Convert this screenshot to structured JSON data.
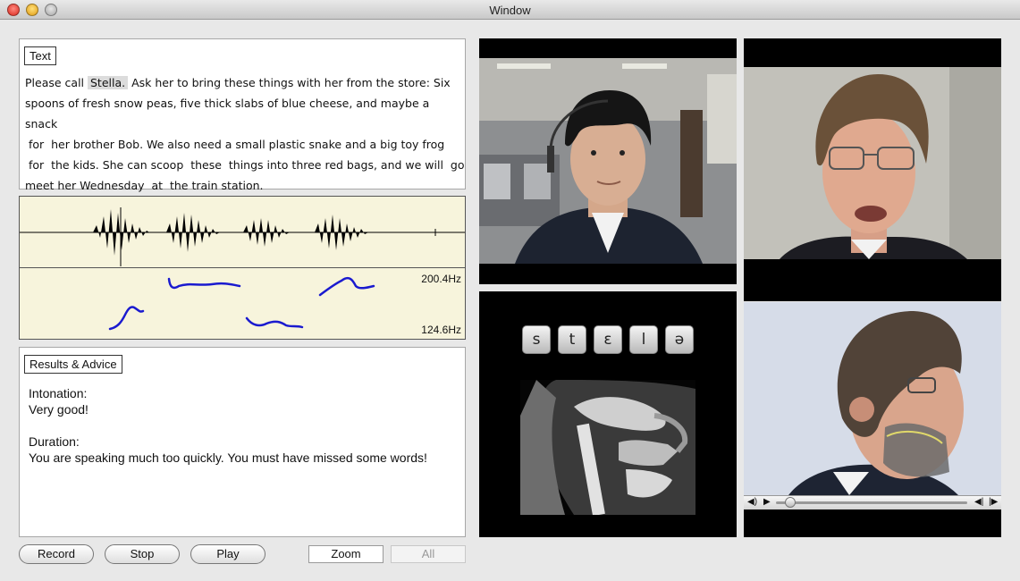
{
  "window": {
    "title": "Window"
  },
  "text_panel": {
    "legend": "Text",
    "lines": [
      [
        "Please call ",
        "Stella.",
        " Ask her to bring these things with her from the store: Six"
      ],
      "spoons of fresh snow peas, five thick slabs of blue cheese, and maybe a snack",
      " for  her brother Bob. We also need a small plastic snake and a big toy frog",
      " for  the kids. She can scoop  these  things into three red bags, and we will  go",
      "meet her Wednesday  at  the train station."
    ]
  },
  "pitch": {
    "max_label": "200.4Hz",
    "min_label": "124.6Hz"
  },
  "results": {
    "legend": "Results & Advice",
    "intonation_label": "Intonation:",
    "intonation_value": "Very good!",
    "duration_label": "Duration:",
    "duration_value": "You are speaking much too quickly. You must have missed some words!"
  },
  "buttons": {
    "record": "Record",
    "stop": "Stop",
    "play": "Play",
    "zoom": "Zoom",
    "all": "All"
  },
  "phonemes": [
    "s",
    "t",
    "ɛ",
    "l",
    "ə"
  ],
  "player_icons": {
    "volume": "speaker-icon",
    "play": "play-icon",
    "prev": "skip-back-icon",
    "next": "skip-forward-icon"
  }
}
